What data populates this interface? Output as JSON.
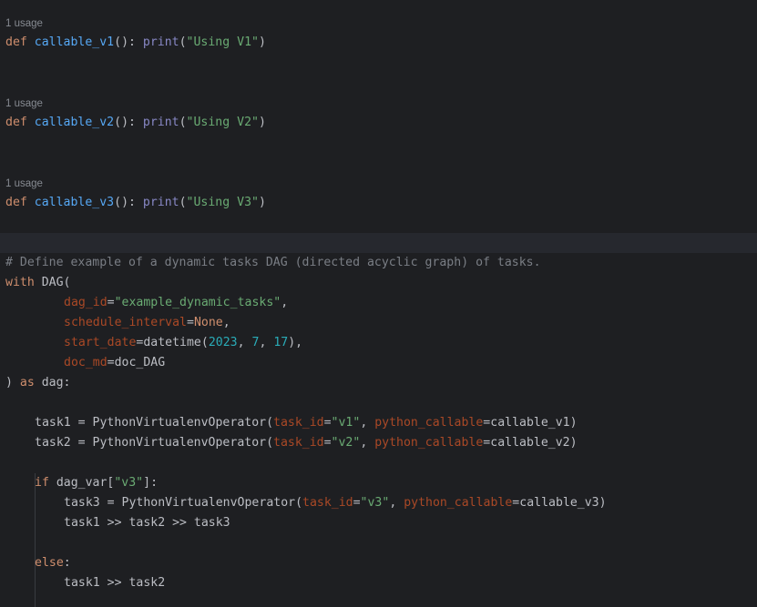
{
  "theme": {
    "background": "#1e1f22",
    "current_line": "#26282e",
    "keyword": "#cf8e6d",
    "function": "#56a8f5",
    "builtin": "#8888c6",
    "string": "#6aab73",
    "number": "#2aacb8",
    "named_arg": "#aa4926",
    "comment": "#7a7e85",
    "text": "#bcbec4"
  },
  "inlays": [
    "1 usage",
    "1 usage",
    "1 usage"
  ],
  "funcs": [
    {
      "kw": "def",
      "name": "callable_v1",
      "paren": "(): ",
      "call": "print",
      "open": "(",
      "arg": "\"Using V1\"",
      "close": ")"
    },
    {
      "kw": "def",
      "name": "callable_v2",
      "paren": "(): ",
      "call": "print",
      "open": "(",
      "arg": "\"Using V2\"",
      "close": ")"
    },
    {
      "kw": "def",
      "name": "callable_v3",
      "paren": "(): ",
      "call": "print",
      "open": "(",
      "arg": "\"Using V3\"",
      "close": ")"
    }
  ],
  "dag": {
    "comment": "# Define example of a dynamic tasks DAG (directed acyclic graph) of tasks.",
    "with_kw": "with",
    "dag_open": " DAG(",
    "dag_id_param": "dag_id",
    "eq": "=",
    "dag_id_value": "\"example_dynamic_tasks\"",
    "comma": ",",
    "schedule_param": "schedule_interval",
    "schedule_value": "None",
    "start_param": "start_date",
    "start_call": "datetime(",
    "year": "2023",
    "sep": ", ",
    "month": "7",
    "day": "17",
    "start_close": "),",
    "doc_param": "doc_md",
    "doc_value": "doc_DAG",
    "close": ")",
    "as_kw": "as",
    "as_target": " dag:"
  },
  "tasks": [
    {
      "var": "task1",
      "assign": " = PythonVirtualenvOperator(",
      "id_param": "task_id",
      "id_value": "\"v1\"",
      "callable_param": "python_callable",
      "callable_value": "callable_v1"
    },
    {
      "var": "task2",
      "assign": " = PythonVirtualenvOperator(",
      "id_param": "task_id",
      "id_value": "\"v2\"",
      "callable_param": "python_callable",
      "callable_value": "callable_v2"
    },
    {
      "var": "task3",
      "assign": " = PythonVirtualenvOperator(",
      "id_param": "task_id",
      "id_value": "\"v3\"",
      "callable_param": "python_callable",
      "callable_value": "callable_v3"
    }
  ],
  "cond": {
    "if_kw": "if",
    "if_subject": " dag_var[",
    "key": "\"v3\"",
    "if_end": "]:",
    "chain_if": "task1 >> task2 >> task3",
    "else_kw": "else",
    "else_colon": ":",
    "chain_else": "task1 >> task2"
  }
}
